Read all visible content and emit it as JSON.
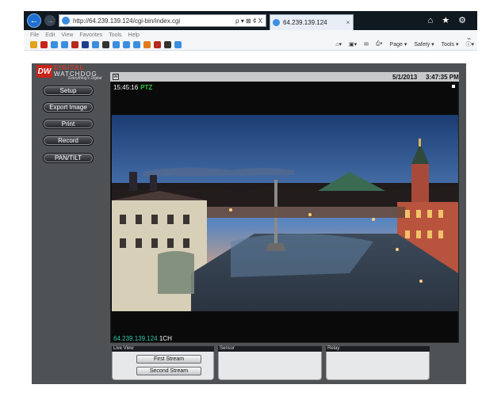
{
  "browser": {
    "address_url": "http://64.239.139.124/cgi-bin/index.cgi",
    "address_tools": "ρ ▾ ⊠ ¢ X",
    "tab_title": "64.239.139.124",
    "tab_close": "×",
    "top_right_icons": "⌂ ★ ⚙",
    "menu": [
      "File",
      "Edit",
      "View",
      "Favorites",
      "Tools",
      "Help"
    ],
    "commands": [
      "Page ▾",
      "Safety ▾",
      "Tools ▾"
    ],
    "overflow": "»"
  },
  "brand": {
    "mark": "DW",
    "name_line1": "DIGITAL",
    "name_line2": "WATCHDOG",
    "tagline": "Everything's Digital"
  },
  "sidebar": {
    "items": [
      {
        "label": "Setup"
      },
      {
        "label": "Export Image"
      },
      {
        "label": "Print"
      },
      {
        "label": "Record"
      },
      {
        "label": "PAN/TILT"
      }
    ]
  },
  "viewer": {
    "close_glyph": "⊠",
    "date": "5/1/2013",
    "time": "3:47:35 PM",
    "osd_time": "15:45:16",
    "osd_ptz": "PTZ",
    "osd_ip": "64.239.139.124",
    "osd_channel": "1CH"
  },
  "panels": {
    "live_view": {
      "title": "Live View",
      "first_stream": "First Stream",
      "second_stream": "Second Stream"
    },
    "sensor": {
      "title": "Sensor"
    },
    "relay": {
      "title": "Relay"
    }
  },
  "colors": {
    "brand_red": "#c8231b",
    "ptz_green": "#2ec43a",
    "ip_cyan": "#2ec4a8",
    "app_gray": "#4f5254"
  },
  "icons": [
    "back-arrow-icon",
    "forward-arrow-icon",
    "ie-icon",
    "home-icon",
    "star-icon",
    "gear-icon",
    "close-icon"
  ]
}
